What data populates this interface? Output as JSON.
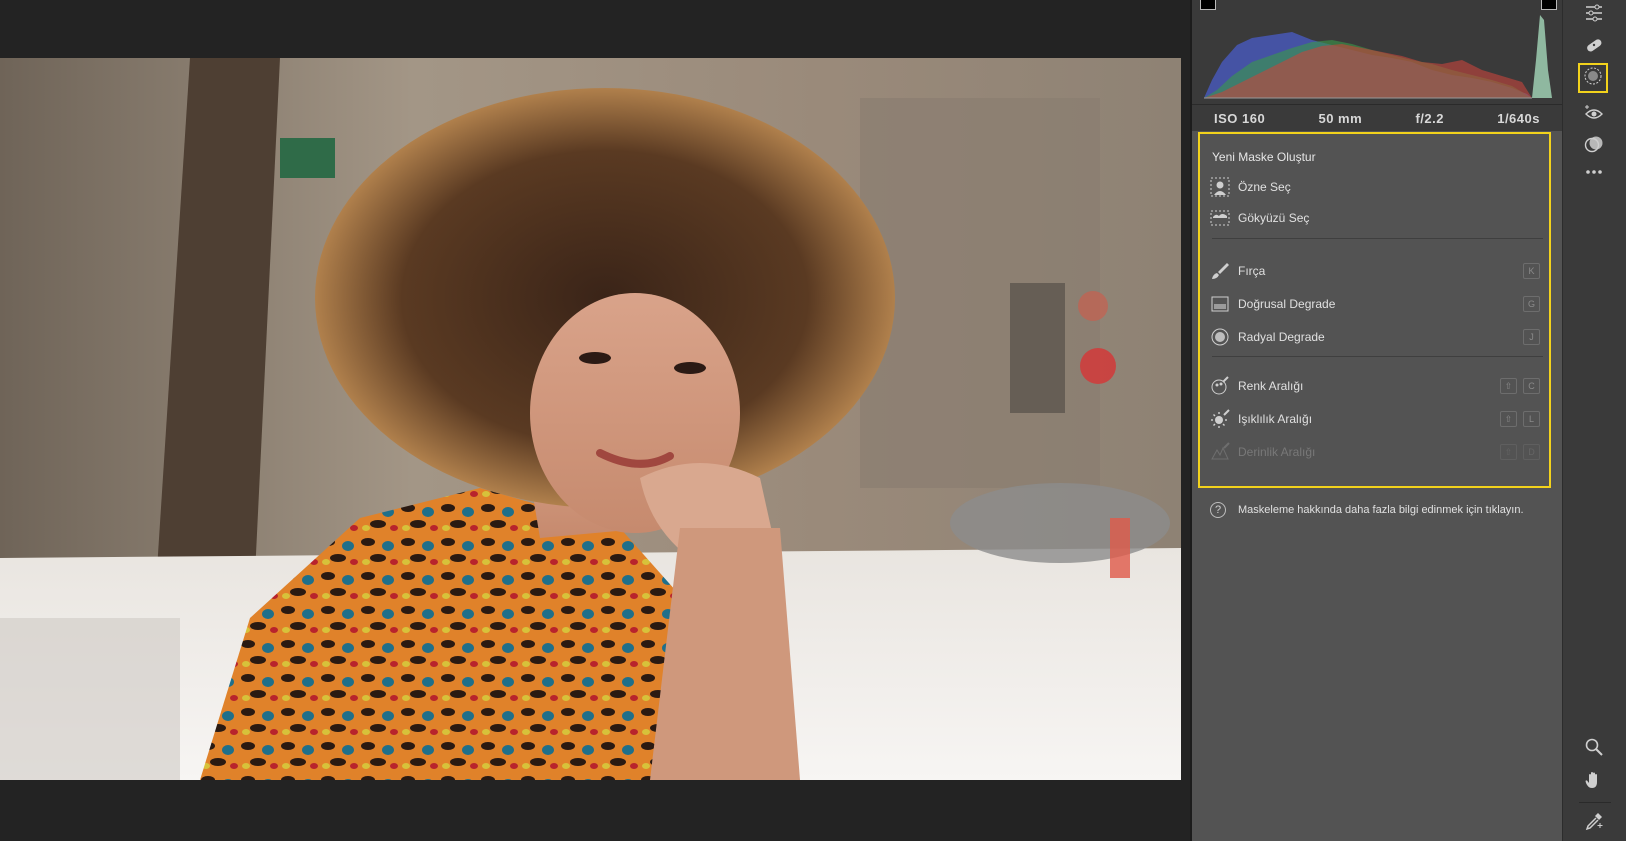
{
  "exif": {
    "iso": "ISO 160",
    "focal": "50 mm",
    "aperture": "f/2.2",
    "shutter": "1/640s"
  },
  "masking": {
    "title": "Yeni Maske Oluştur",
    "items": [
      {
        "label": "Özne Seç",
        "icon": "subject-icon",
        "keys": []
      },
      {
        "label": "Gökyüzü Seç",
        "icon": "sky-icon",
        "keys": []
      },
      {
        "label": "Fırça",
        "icon": "brush-icon",
        "keys": [
          "K"
        ]
      },
      {
        "label": "Doğrusal Degrade",
        "icon": "linear-gradient-icon",
        "keys": [
          "G"
        ]
      },
      {
        "label": "Radyal Degrade",
        "icon": "radial-gradient-icon",
        "keys": [
          "J"
        ]
      },
      {
        "label": "Renk Aralığı",
        "icon": "color-range-icon",
        "keys": [
          "⇧",
          "C"
        ]
      },
      {
        "label": "Işıklılık Aralığı",
        "icon": "luminance-range-icon",
        "keys": [
          "⇧",
          "L"
        ]
      },
      {
        "label": "Derinlik Aralığı",
        "icon": "depth-range-icon",
        "keys": [
          "⇧",
          "D"
        ],
        "disabled": true
      }
    ],
    "help": "Maskeleme hakkında daha fazla bilgi edinmek için tıklayın."
  },
  "toolbar": {
    "tools": [
      "edit-sliders-icon",
      "healing-bandage-icon",
      "masking-icon",
      "red-eye-icon",
      "presets-icon",
      "more-icon",
      "zoom-icon",
      "hand-icon",
      "eyedropper-icon"
    ],
    "active": "masking-icon"
  },
  "colors": {
    "highlight": "#f2d21c",
    "panel": "#535353",
    "toolbar": "#3a3a3a",
    "canvas": "#232323"
  }
}
